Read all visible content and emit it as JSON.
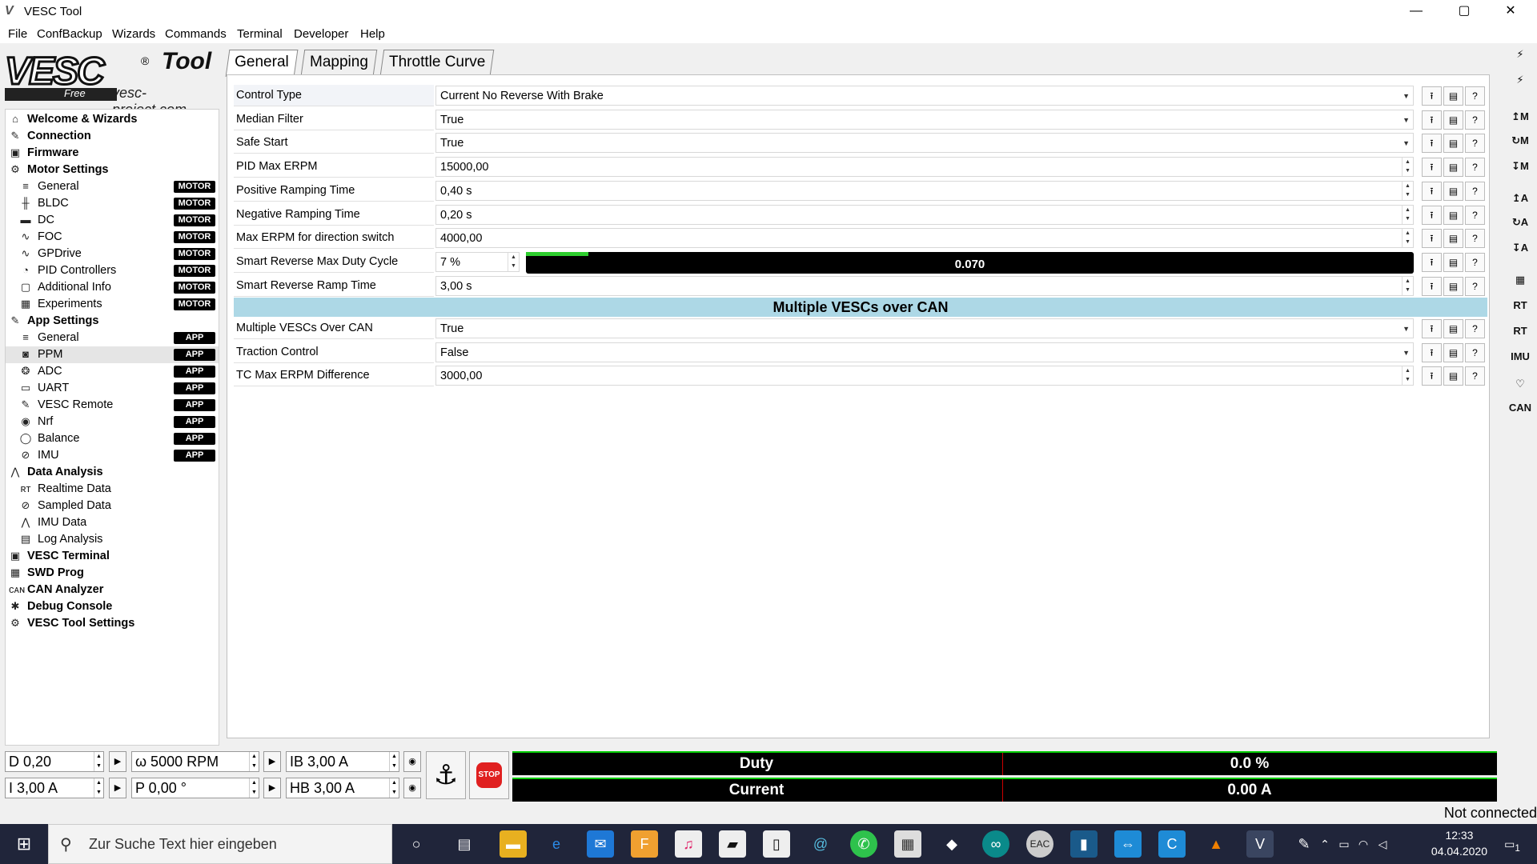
{
  "window": {
    "title": "VESC Tool",
    "minimize": "—",
    "maximize": "▢",
    "close": "✕"
  },
  "menu": [
    "File",
    "ConfBackup",
    "Wizards",
    "Commands",
    "Terminal",
    "Developer",
    "Help"
  ],
  "brand": {
    "name": "VESC",
    "tool": "Tool",
    "free": "Free",
    "site": "vesc-project.com"
  },
  "sidebar": {
    "items": [
      {
        "label": "Welcome & Wizards",
        "icon": "home-icon",
        "glyph": "⌂",
        "level": 1
      },
      {
        "label": "Connection",
        "icon": "plug-icon",
        "glyph": "✎",
        "level": 1
      },
      {
        "label": "Firmware",
        "icon": "chip-icon",
        "glyph": "▣",
        "level": 1
      },
      {
        "label": "Motor Settings",
        "icon": "motor-icon",
        "glyph": "⚙",
        "level": 1
      },
      {
        "label": "General",
        "icon": "sliders-icon",
        "glyph": "≡",
        "level": 2,
        "badge": "MOTOR"
      },
      {
        "label": "BLDC",
        "icon": "bldc-icon",
        "glyph": "╫",
        "level": 2,
        "badge": "MOTOR"
      },
      {
        "label": "DC",
        "icon": "dc-icon",
        "glyph": "▬",
        "level": 2,
        "badge": "MOTOR"
      },
      {
        "label": "FOC",
        "icon": "foc-icon",
        "glyph": "∿",
        "level": 2,
        "badge": "MOTOR"
      },
      {
        "label": "GPDrive",
        "icon": "gpdrive-icon",
        "glyph": "∿",
        "level": 2,
        "badge": "MOTOR"
      },
      {
        "label": "PID Controllers",
        "icon": "pid-icon",
        "glyph": "◔",
        "level": 2,
        "badge": "MOTOR"
      },
      {
        "label": "Additional Info",
        "icon": "info-icon",
        "glyph": "▢",
        "level": 2,
        "badge": "MOTOR"
      },
      {
        "label": "Experiments",
        "icon": "experiments-icon",
        "glyph": "▦",
        "level": 2,
        "badge": "MOTOR"
      },
      {
        "label": "App Settings",
        "icon": "app-settings-icon",
        "glyph": "✎",
        "level": 1
      },
      {
        "label": "General",
        "icon": "sliders-icon",
        "glyph": "≡",
        "level": 2,
        "badge": "APP"
      },
      {
        "label": "PPM",
        "icon": "gamepad-icon",
        "glyph": "◙",
        "level": 2,
        "badge": "APP",
        "selected": true
      },
      {
        "label": "ADC",
        "icon": "adc-icon",
        "glyph": "❂",
        "level": 2,
        "badge": "APP"
      },
      {
        "label": "UART",
        "icon": "uart-icon",
        "glyph": "▭",
        "level": 2,
        "badge": "APP"
      },
      {
        "label": "VESC Remote",
        "icon": "remote-icon",
        "glyph": "✎",
        "level": 2,
        "badge": "APP"
      },
      {
        "label": "Nrf",
        "icon": "wireless-icon",
        "glyph": "◉",
        "level": 2,
        "badge": "APP"
      },
      {
        "label": "Balance",
        "icon": "balance-icon",
        "glyph": "◯",
        "level": 2,
        "badge": "APP"
      },
      {
        "label": "IMU",
        "icon": "imu-icon",
        "glyph": "⊘",
        "level": 2,
        "badge": "APP"
      },
      {
        "label": "Data Analysis",
        "icon": "chart-icon",
        "glyph": "⋀",
        "level": 1
      },
      {
        "label": "Realtime Data",
        "icon": "realtime-icon",
        "glyph": "ʀᴛ",
        "level": 2
      },
      {
        "label": "Sampled Data",
        "icon": "sampled-icon",
        "glyph": "⊘",
        "level": 2
      },
      {
        "label": "IMU Data",
        "icon": "imu-data-icon",
        "glyph": "⋀",
        "level": 2
      },
      {
        "label": "Log Analysis",
        "icon": "log-icon",
        "glyph": "▤",
        "level": 2
      },
      {
        "label": "VESC Terminal",
        "icon": "terminal-icon",
        "glyph": "▣",
        "level": 1
      },
      {
        "label": "SWD Prog",
        "icon": "swd-icon",
        "glyph": "▦",
        "level": 1
      },
      {
        "label": "CAN Analyzer",
        "icon": "can-icon",
        "glyph": "ᴄᴀɴ",
        "level": 1
      },
      {
        "label": "Debug Console",
        "icon": "bug-icon",
        "glyph": "✱",
        "level": 1
      },
      {
        "label": "VESC Tool Settings",
        "icon": "gear-icon",
        "glyph": "⚙",
        "level": 1
      }
    ]
  },
  "tabs": [
    {
      "label": "General",
      "active": true
    },
    {
      "label": "Mapping",
      "active": false
    },
    {
      "label": "Throttle Curve",
      "active": false
    }
  ],
  "params": [
    {
      "label": "Control Type",
      "value": "Current No Reverse With Brake",
      "kind": "combo"
    },
    {
      "label": "Median Filter",
      "value": "True",
      "kind": "combo"
    },
    {
      "label": "Safe Start",
      "value": "True",
      "kind": "combo"
    },
    {
      "label": "PID Max ERPM",
      "value": "15000,00",
      "kind": "spin"
    },
    {
      "label": "Positive Ramping Time",
      "value": "0,40 s",
      "kind": "spin"
    },
    {
      "label": "Negative Ramping Time",
      "value": "0,20 s",
      "kind": "spin"
    },
    {
      "label": "Max ERPM for direction switch",
      "value": "4000,00",
      "kind": "spin"
    },
    {
      "label": "Smart Reverse Max Duty Cycle",
      "value": "7 %",
      "kind": "duty",
      "bar_text": "0.070",
      "bar_fraction": 0.07
    },
    {
      "label": "Smart Reverse Ramp Time",
      "value": "3,00 s",
      "kind": "spin"
    }
  ],
  "section_title": "Multiple VESCs over CAN",
  "params2": [
    {
      "label": "Multiple VESCs Over CAN",
      "value": "True",
      "kind": "combo"
    },
    {
      "label": "Traction Control",
      "value": "False",
      "kind": "combo"
    },
    {
      "label": "TC Max ERPM Difference",
      "value": "3000,00",
      "kind": "spin"
    }
  ],
  "row_buttons": {
    "upload": "⭱",
    "read_default": "▤",
    "help": "?"
  },
  "right_toolbar": [
    "⚡",
    "⚡",
    "↥M",
    "↻M",
    "↧M",
    "↥A",
    "↻A",
    "↧A",
    "▦",
    "RT",
    "RT",
    "IMU",
    "♡",
    "CAN"
  ],
  "bottom": {
    "duty": "D 0,20",
    "current": "I 3,00 A",
    "rpm": "ω 5000 RPM",
    "position": "P 0,00 °",
    "brake_current": "IB 3,00 A",
    "handbrake": "HB 3,00 A",
    "stop": "STOP",
    "anchor": "⚓",
    "meters": [
      {
        "label": "Duty",
        "value": "0.0 %"
      },
      {
        "label": "Current",
        "value": "0.00 A"
      }
    ],
    "status": "Not connected"
  },
  "taskbar": {
    "search_placeholder": "Zur Suche Text hier eingeben",
    "time": "12:33",
    "date": "04.04.2020",
    "notifications": "1",
    "eac": "EAC"
  }
}
